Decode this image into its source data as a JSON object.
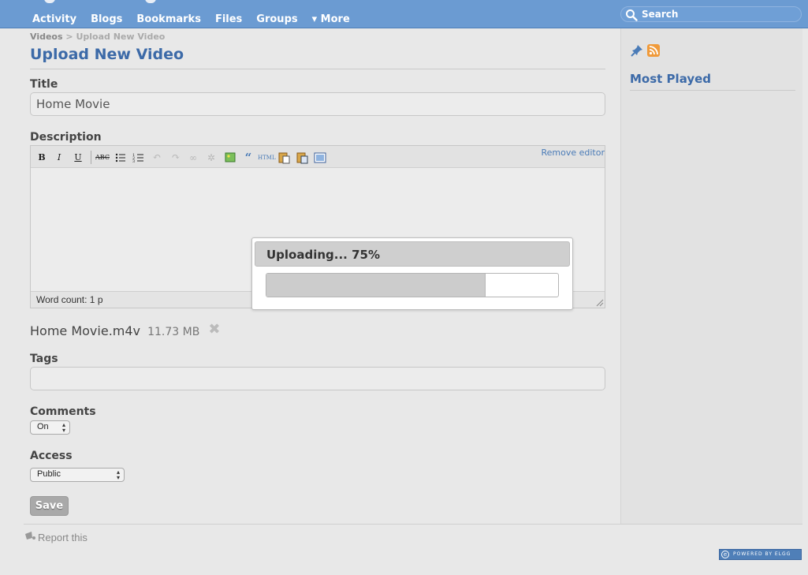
{
  "topbar": {
    "nav": [
      "Activity",
      "Blogs",
      "Bookmarks",
      "Files",
      "Groups",
      "▾ More"
    ],
    "search_placeholder": "Search"
  },
  "breadcrumb": {
    "parent": "Videos",
    "separator": ">",
    "current": "Upload New Video"
  },
  "page_title": "Upload New Video",
  "form": {
    "title_label": "Title",
    "title_value": "Home Movie",
    "description_label": "Description",
    "remove_editor": "Remove editor",
    "toolbar_icons": [
      "bold-icon",
      "italic-icon",
      "underline-icon",
      "strikethrough-icon",
      "bullet-list-icon",
      "numbered-list-icon",
      "undo-icon",
      "redo-icon",
      "link-icon",
      "unlink-icon",
      "image-icon",
      "blockquote-icon",
      "html-icon",
      "paste-text-icon",
      "paste-word-icon",
      "fullscreen-icon"
    ],
    "toolbar_labels": {
      "bold": "B",
      "italic": "I",
      "underline": "U",
      "strike": "ABC",
      "html": "HTML"
    },
    "word_count": "Word count: 1 p",
    "file_name": "Home Movie.m4v",
    "file_size": "11.73 MB",
    "tags_label": "Tags",
    "tags_value": "",
    "comments_label": "Comments",
    "comments_value": "On",
    "access_label": "Access",
    "access_value": "Public",
    "save_label": "Save"
  },
  "sidebar": {
    "title": "Most Played"
  },
  "footer": {
    "report": "Report this",
    "powered": "POWERED BY ELGG"
  },
  "upload_modal": {
    "status": "Uploading... 75%",
    "progress_percent": 75
  },
  "colors": {
    "topbar": "#6b9bd2",
    "title": "#3c6aa8",
    "progress_fill": "#cccccc"
  }
}
